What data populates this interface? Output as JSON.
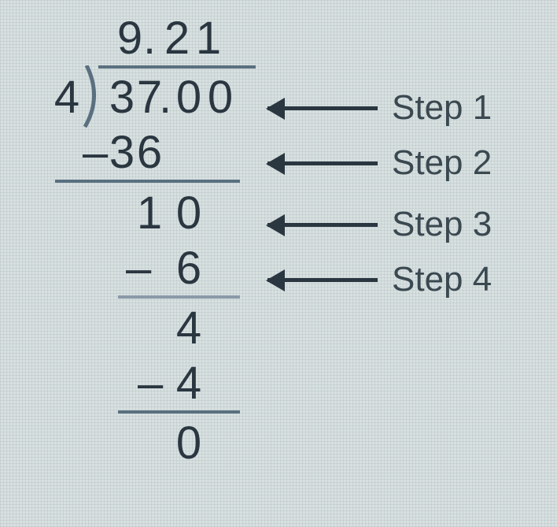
{
  "division": {
    "divisor": "4",
    "quotient": [
      "9",
      ".",
      "2",
      "1"
    ],
    "dividend": [
      "3",
      "7",
      ".",
      "0",
      "0"
    ],
    "row_sub1_minus": "–",
    "row_sub1": [
      "3",
      "6"
    ],
    "row_res1": [
      "1",
      "0"
    ],
    "row_sub2_minus": "–",
    "row_sub2": [
      "6"
    ],
    "row_res2": [
      "4"
    ],
    "row_sub3_minus": "–",
    "row_sub3": [
      "4"
    ],
    "row_final": [
      "0"
    ]
  },
  "steps": {
    "s1": "Step 1",
    "s2": "Step 2",
    "s3": "Step 3",
    "s4": "Step 4"
  }
}
